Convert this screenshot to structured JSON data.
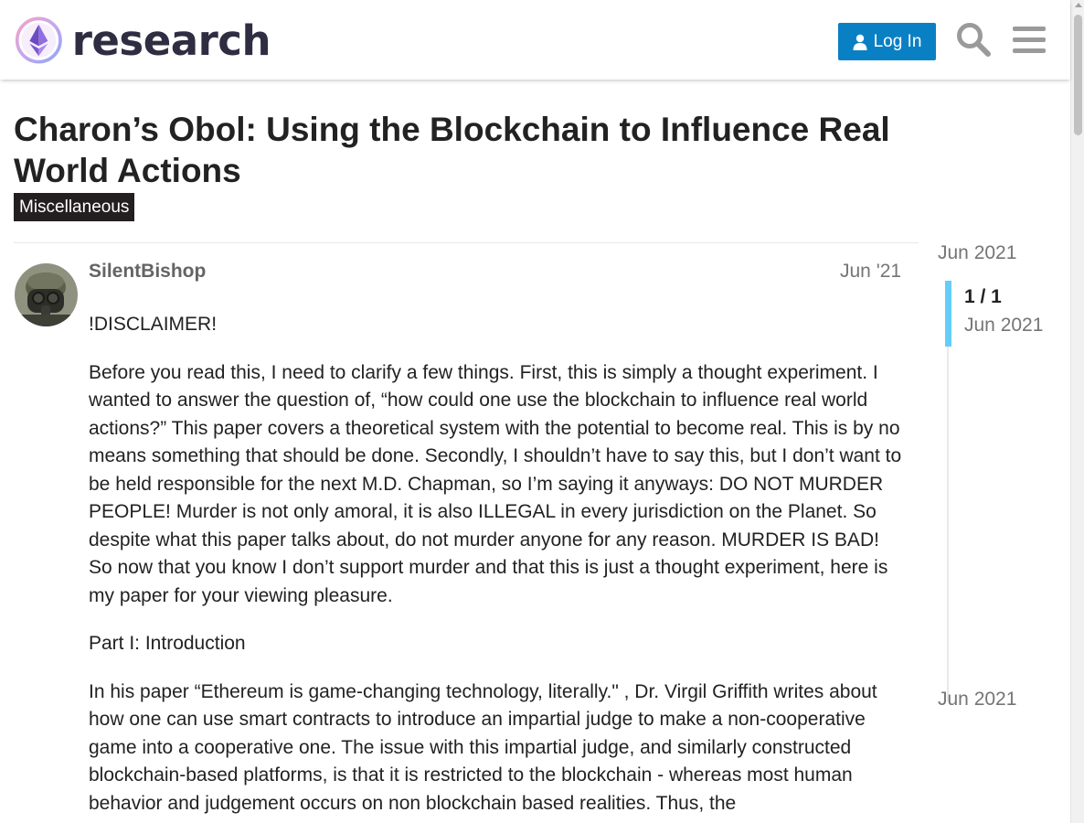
{
  "header": {
    "logo_text": "research",
    "login_label": "Log In",
    "icons": [
      "user-icon",
      "search-icon",
      "hamburger-menu-icon"
    ],
    "accent_color": "#0a80c4"
  },
  "topic": {
    "title": "Charon’s Obol: Using the Blockchain to Influence Real World Actions",
    "category": "Miscellaneous",
    "category_color": "#231f20"
  },
  "post": {
    "username": "SilentBishop",
    "date": "Jun '21",
    "paragraphs": [
      "!DISCLAIMER!",
      "Before you read this, I need to clarify a few things. First, this is simply a thought experiment. I wanted to answer the question of, “how could one use the blockchain to influence real world actions?” This paper covers a theoretical system with the potential to become real. This is by no means something that should be done. Secondly, I shouldn’t have to say this, but I don’t want to be held responsible for the next M.D. Chapman, so I’m saying it anyways: DO NOT MURDER PEOPLE! Murder is not only amoral, it is also ILLEGAL in every jurisdiction on the Planet. So despite what this paper talks about, do not murder anyone for any reason. MURDER IS BAD! So now that you know I don’t support murder and that this is just a thought experiment, here is my paper for your viewing pleasure.",
      "Part I: Introduction",
      "In his paper “Ethereum is game-changing technology, literally.\" , Dr. Virgil Griffith writes about how one can use smart contracts to introduce an impartial judge to make a non-cooperative game into a cooperative one. The issue with this impartial judge, and similarly constructed blockchain-based platforms, is that it is restricted to the blockchain - whereas most human behavior and judgement occurs on non blockchain based realities. Thus, the"
    ]
  },
  "timeline": {
    "top_date": "Jun 2021",
    "count": "1 / 1",
    "count_date": "Jun 2021",
    "bottom_date": "Jun 2021",
    "progress_fraction": 1.0,
    "handle_color": "#65cdf9"
  }
}
